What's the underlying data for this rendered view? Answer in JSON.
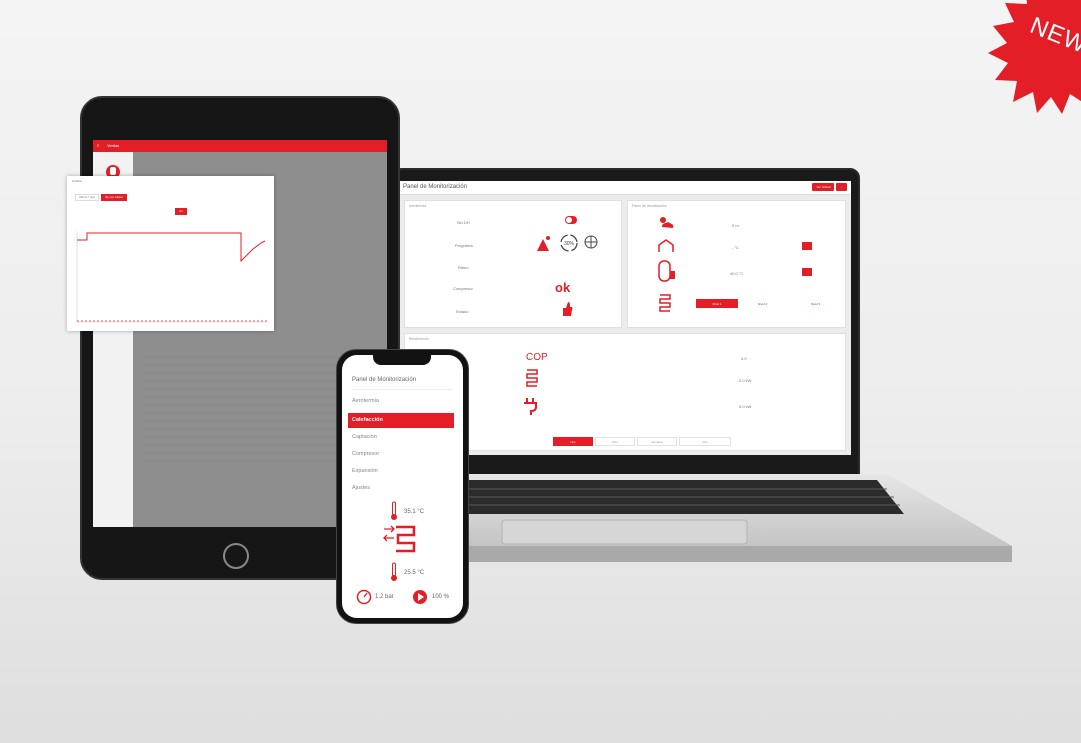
{
  "badge": {
    "text": "NEW"
  },
  "laptop": {
    "title": "Panel de Monitorización",
    "header_buttons": [
      "Ver Global",
      "..."
    ],
    "panel_left": {
      "title": "Aerotermia",
      "labels": [
        "Sin DH",
        "Programa",
        "Ritmo",
        "Compresor",
        "Estado"
      ],
      "status": "ok"
    },
    "panel_right": {
      "title": "Panel de climatización",
      "values": [
        "0 m",
        "- °C",
        "40.0 °C"
      ],
      "buttons": [
        "Nivel 1",
        "Nivel 2",
        "Nivel 3"
      ]
    },
    "panel_bottom": {
      "title": "Rendimiento",
      "cop": "COP",
      "values": [
        "0.0",
        "0.0 kW",
        "0.0 kW"
      ],
      "tabs": [
        "Hoy",
        "Mes",
        "Semana",
        "Año"
      ]
    }
  },
  "tablet": {
    "topbar_title": "Veritas",
    "modal_title": "Gráfica",
    "modal_buttons": [
      "Ultimos 7 días",
      "Hoy con valores"
    ],
    "modal_submit": "Ver"
  },
  "phone": {
    "title": "Panel de Monitorización",
    "menu": [
      "Aerotermia",
      "Calefacción",
      "Captación",
      "Compresor",
      "Expansión",
      "Ajustes"
    ],
    "active_index": 1,
    "temp_top": "35.1 °C",
    "temp_bottom": "25.5 °C",
    "pressure": "1.2 bar",
    "pump": "100 %"
  },
  "colors": {
    "accent": "#e41e26",
    "device": "#161616"
  }
}
